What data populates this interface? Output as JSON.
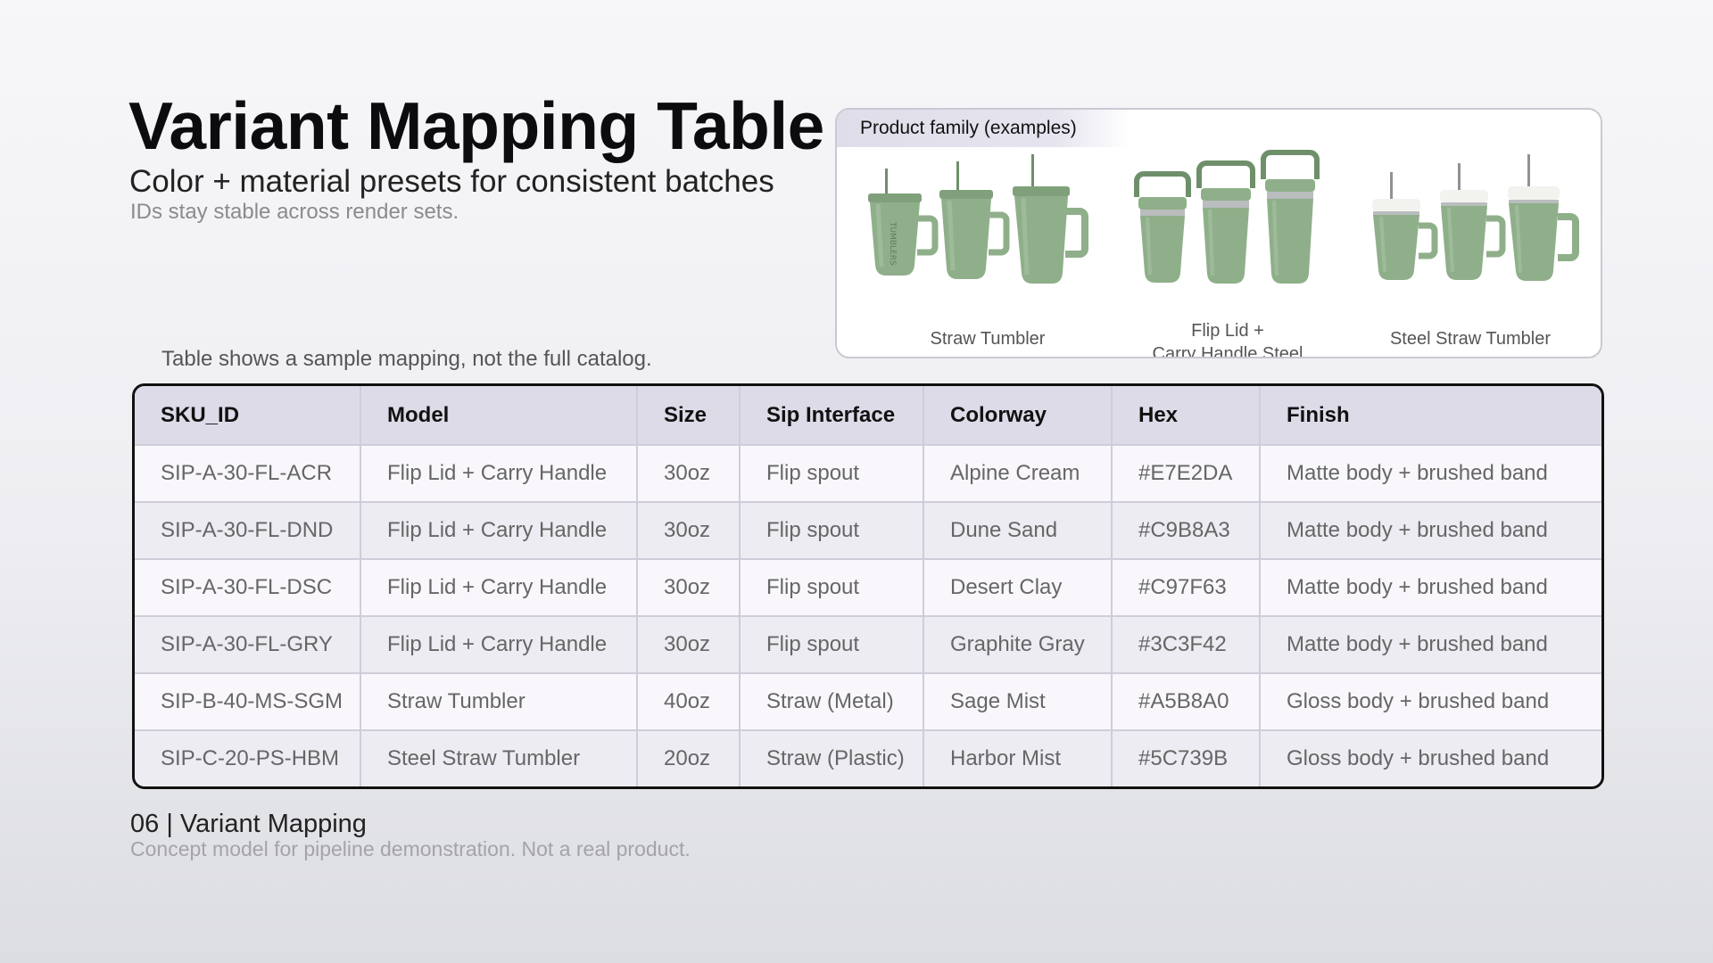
{
  "header": {
    "title": "Variant Mapping Table",
    "subtitle": "Color + material presets for consistent batches",
    "note": "IDs stay stable across render sets."
  },
  "product_family": {
    "label": "Product family (examples)",
    "groups": [
      {
        "caption": "Straw Tumbler",
        "print": "TUMBLERS"
      },
      {
        "caption_line1": "Flip Lid +",
        "caption_line2": "Carry Handle Steel"
      },
      {
        "caption": "Steel Straw Tumbler"
      }
    ],
    "colors": {
      "body": "#8FAF8A",
      "shade": "#6E8F6A",
      "highlight": "#A9C3A3",
      "lid": "#F2F2EE",
      "metal": "#B9BDBE",
      "handle_dark": "#5F7F5B"
    }
  },
  "table": {
    "caption": "Table shows a sample mapping, not the full catalog.",
    "columns": [
      "SKU_ID",
      "Model",
      "Size",
      "Sip Interface",
      "Colorway",
      "Hex",
      "Finish"
    ],
    "rows": [
      [
        "SIP-A-30-FL-ACR",
        "Flip Lid + Carry Handle",
        "30oz",
        "Flip spout",
        "Alpine Cream",
        "#E7E2DA",
        "Matte body + brushed band"
      ],
      [
        "SIP-A-30-FL-DND",
        "Flip Lid + Carry Handle",
        "30oz",
        "Flip spout",
        "Dune Sand",
        "#C9B8A3",
        "Matte body + brushed band"
      ],
      [
        "SIP-A-30-FL-DSC",
        "Flip Lid + Carry Handle",
        "30oz",
        "Flip spout",
        "Desert Clay",
        "#C97F63",
        "Matte body + brushed band"
      ],
      [
        "SIP-A-30-FL-GRY",
        "Flip Lid + Carry Handle",
        "30oz",
        "Flip spout",
        "Graphite Gray",
        "#3C3F42",
        "Matte body + brushed band"
      ],
      [
        "SIP-B-40-MS-SGM",
        "Straw Tumbler",
        "40oz",
        "Straw (Metal)",
        "Sage Mist",
        "#A5B8A0",
        "Gloss body + brushed band"
      ],
      [
        "SIP-C-20-PS-HBM",
        "Steel Straw Tumbler",
        "20oz",
        "Straw (Plastic)",
        "Harbor Mist",
        "#5C739B",
        "Gloss body + brushed band"
      ]
    ]
  },
  "footer": {
    "title": "06 | Variant Mapping",
    "note": "Concept model for pipeline demonstration. Not a real product."
  }
}
